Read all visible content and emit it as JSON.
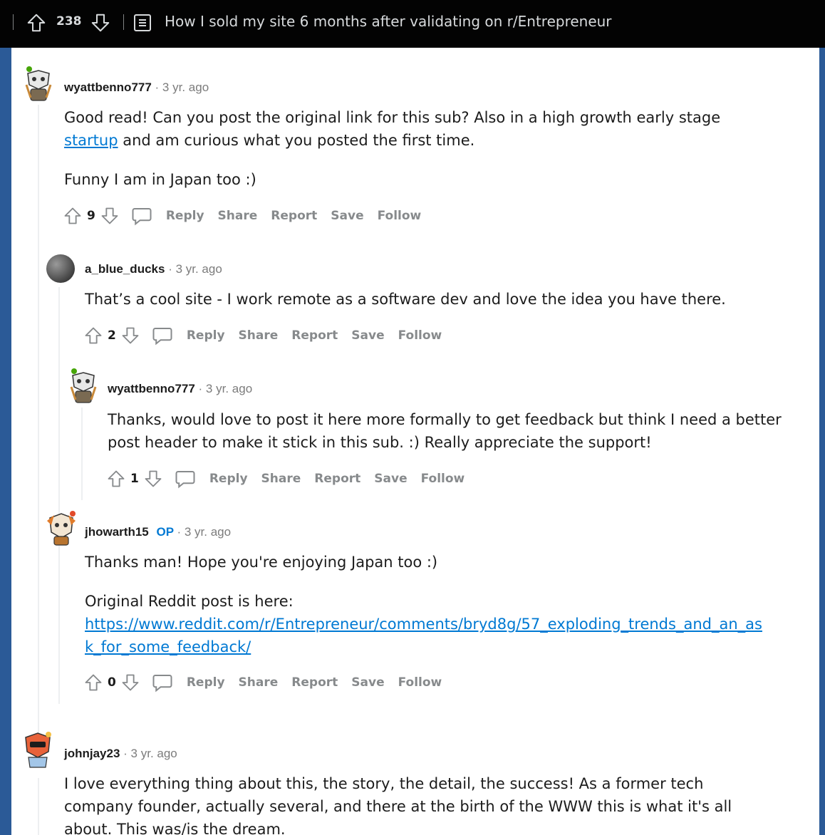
{
  "header": {
    "score": "238",
    "title": "How I sold my site 6 months after validating on r/Entrepreneur"
  },
  "actions": {
    "reply": "Reply",
    "share": "Share",
    "report": "Report",
    "save": "Save",
    "follow": "Follow"
  },
  "comments": [
    {
      "username": "wyattbenno777",
      "time": "· 3 yr. ago",
      "paragraphs": [
        {
          "before": "Good read! Can you post the original link for this sub? Also in a high growth early stage ",
          "link": "startup",
          "after": " and am curious what you posted the first time."
        },
        {
          "text": "Funny I am in Japan too :)"
        }
      ],
      "votes": "9"
    },
    {
      "username": "a_blue_ducks",
      "time": "· 3 yr. ago",
      "paragraphs": [
        {
          "text": "That’s a cool site - I work remote as a software dev and love the idea you have there."
        }
      ],
      "votes": "2"
    },
    {
      "username": "wyattbenno777",
      "time": "· 3 yr. ago",
      "paragraphs": [
        {
          "text": "Thanks, would love to post it here more formally to get feedback but think I need a better post header to make it stick in this sub. :) Really appreciate the support!"
        }
      ],
      "votes": "1"
    },
    {
      "username": "jhowarth15",
      "op": "OP",
      "time": "· 3 yr. ago",
      "paragraphs": [
        {
          "text": "Thanks man! Hope you're enjoying Japan too :)"
        },
        {
          "text": "Original Reddit post is here:",
          "link": "https://www.reddit.com/r/Entrepreneur/comments/bryd8g/57_exploding_trends_and_an_ask_for_some_feedback/"
        }
      ],
      "votes": "0"
    },
    {
      "username": "johnjay23",
      "time": "· 3 yr. ago",
      "paragraphs": [
        {
          "text": "I love everything thing about this, the story, the detail, the success! As a former tech company founder, actually several, and there at the birth of the WWW this is what it's all about. This was/is the dream."
        }
      ]
    }
  ],
  "colors": {
    "page_bg": "#2b5a97",
    "topbar_bg": "#030303",
    "link": "#0079d3",
    "muted": "#878a8c"
  }
}
